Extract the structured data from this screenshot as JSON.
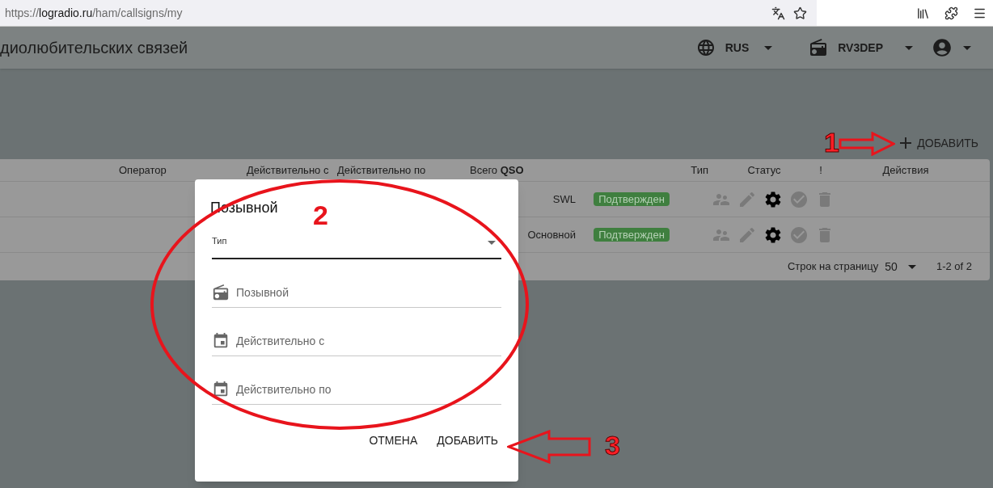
{
  "browser": {
    "url": {
      "scheme": "https://",
      "domain": "logradio.ru",
      "path": "/ham/callsigns/my"
    }
  },
  "app_bar": {
    "title": "диолюбительских связей",
    "language": "RUS",
    "callsign": "RV3DEP"
  },
  "add_button": {
    "label": "ДОБАВИТЬ"
  },
  "table": {
    "columns": [
      "Оператор",
      "Действительно с",
      "Действительно по",
      "Всего **QSO**",
      "Тип",
      "Статус",
      "!",
      "Действия"
    ],
    "rows": [
      {
        "type": "SWL",
        "status": "Подтвержден",
        "actions": [
          {
            "kind": "people",
            "disabled": true
          },
          {
            "kind": "edit",
            "disabled": true
          },
          {
            "kind": "settings",
            "disabled": false
          },
          {
            "kind": "check",
            "disabled": true
          },
          {
            "kind": "delete",
            "disabled": true
          }
        ]
      },
      {
        "type": "Основной",
        "status": "Подтвержден",
        "actions": [
          {
            "kind": "people",
            "disabled": true
          },
          {
            "kind": "edit",
            "disabled": true
          },
          {
            "kind": "settings",
            "disabled": false
          },
          {
            "kind": "check",
            "disabled": true
          },
          {
            "kind": "delete",
            "disabled": true
          }
        ]
      }
    ],
    "footer": {
      "rows_label": "Строк на страницу",
      "rows_per_page": "50",
      "range": "1-2 of 2"
    }
  },
  "dialog": {
    "title": "Позывной",
    "select": {
      "label": "Тип"
    },
    "fields": [
      {
        "kind": "radio",
        "placeholder": "Позывной"
      },
      {
        "kind": "date",
        "placeholder": "Действительно с"
      },
      {
        "kind": "date",
        "placeholder": "Действительно по"
      }
    ],
    "buttons": [
      {
        "label": "ОТМЕНА"
      },
      {
        "label": "ДОБАВИТЬ"
      }
    ]
  },
  "annotations": [
    {
      "label": "1"
    },
    {
      "label": "2"
    },
    {
      "label": "3"
    }
  ]
}
